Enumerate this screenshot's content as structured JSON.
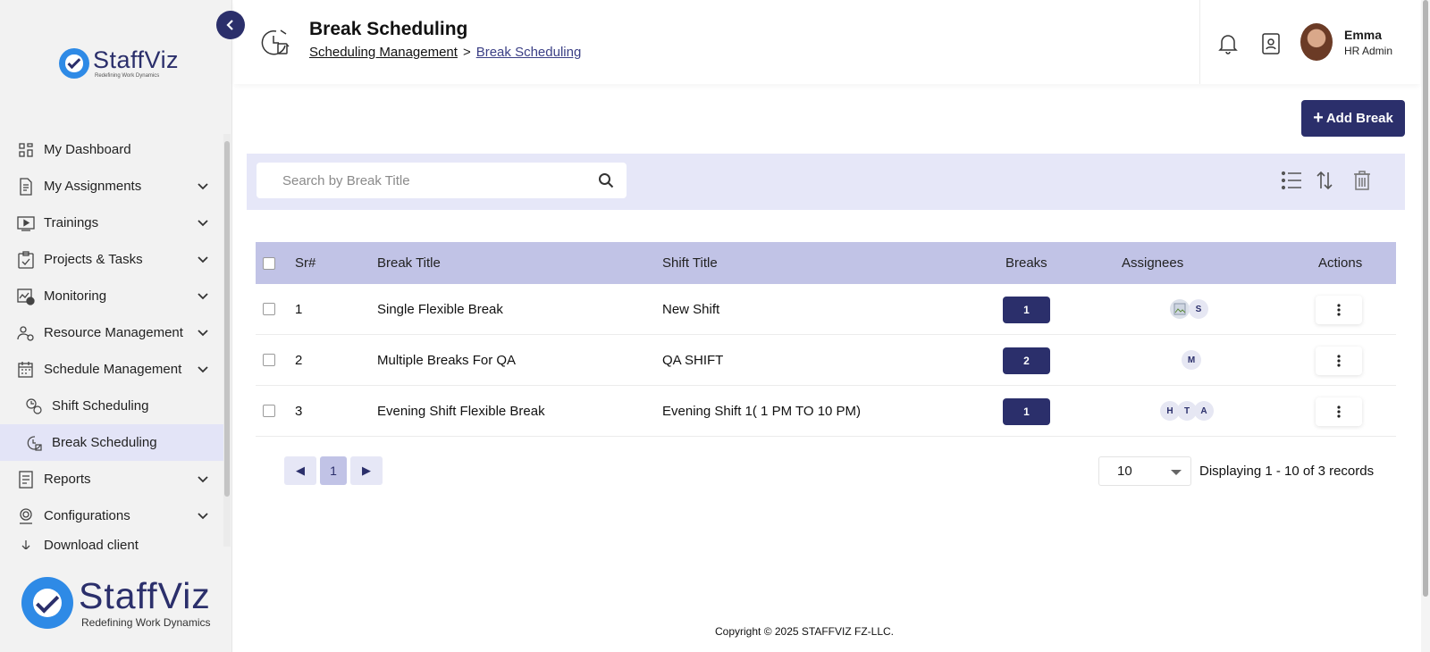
{
  "app": {
    "brand": "StaffViz",
    "tagline": "Redefining Work Dynamics"
  },
  "sidebar": {
    "items": [
      {
        "label": "My Dashboard",
        "icon": "dashboard-icon",
        "expandable": false
      },
      {
        "label": "My Assignments",
        "icon": "assignments-icon",
        "expandable": true
      },
      {
        "label": "Trainings",
        "icon": "play-icon",
        "expandable": true
      },
      {
        "label": "Projects & Tasks",
        "icon": "clipboard-icon",
        "expandable": true
      },
      {
        "label": "Monitoring",
        "icon": "monitoring-icon",
        "expandable": true
      },
      {
        "label": "Resource Management",
        "icon": "resource-icon",
        "expandable": true
      },
      {
        "label": "Schedule Management",
        "icon": "calendar-icon",
        "expandable": true
      },
      {
        "label": "Shift Scheduling",
        "icon": "shift-icon",
        "expandable": false,
        "sub": true
      },
      {
        "label": "Break Scheduling",
        "icon": "break-icon",
        "expandable": false,
        "sub": true,
        "active": true
      },
      {
        "label": "Reports",
        "icon": "report-icon",
        "expandable": true
      },
      {
        "label": "Configurations",
        "icon": "config-icon",
        "expandable": true
      },
      {
        "label": "Download client",
        "icon": "download-icon",
        "expandable": false
      }
    ]
  },
  "header": {
    "title": "Break Scheduling",
    "breadcrumb": [
      "Scheduling Management",
      "Break Scheduling"
    ],
    "breadcrumb_separator": ">",
    "user": {
      "name": "Emma",
      "role": "HR Admin"
    }
  },
  "actions": {
    "add_label": "Add Break"
  },
  "search": {
    "placeholder": "Search by Break Title"
  },
  "table": {
    "columns": [
      "Sr#",
      "Break Title",
      "Shift Title",
      "Breaks",
      "Assignees",
      "Actions"
    ],
    "rows": [
      {
        "sr": "1",
        "break_title": "Single Flexible Break",
        "shift_title": "New Shift",
        "breaks": "1",
        "assignees": [
          {
            "type": "image"
          },
          {
            "initial": "S"
          }
        ]
      },
      {
        "sr": "2",
        "break_title": "Multiple Breaks For QA",
        "shift_title": "QA SHIFT",
        "breaks": "2",
        "assignees": [
          {
            "initial": "M"
          }
        ]
      },
      {
        "sr": "3",
        "break_title": "Evening Shift Flexible Break",
        "shift_title": "Evening Shift 1( 1 PM TO 10 PM)",
        "breaks": "1",
        "assignees": [
          {
            "initial": "H"
          },
          {
            "initial": "T"
          },
          {
            "initial": "A"
          }
        ]
      }
    ]
  },
  "pagination": {
    "prev": "◀",
    "current_page": "1",
    "next": "▶",
    "page_size": "10",
    "summary": "Displaying 1 - 10 of 3 records"
  },
  "footer": {
    "copyright": "Copyright © 2025 STAFFVIZ FZ-LLC."
  },
  "colors": {
    "primary": "#2b2f6b",
    "toolbar_bg": "#e6e7f8",
    "table_header_bg": "#c1c3e6",
    "active_nav_bg": "#e3e4f7",
    "logo_blue": "#2e8ae6"
  }
}
